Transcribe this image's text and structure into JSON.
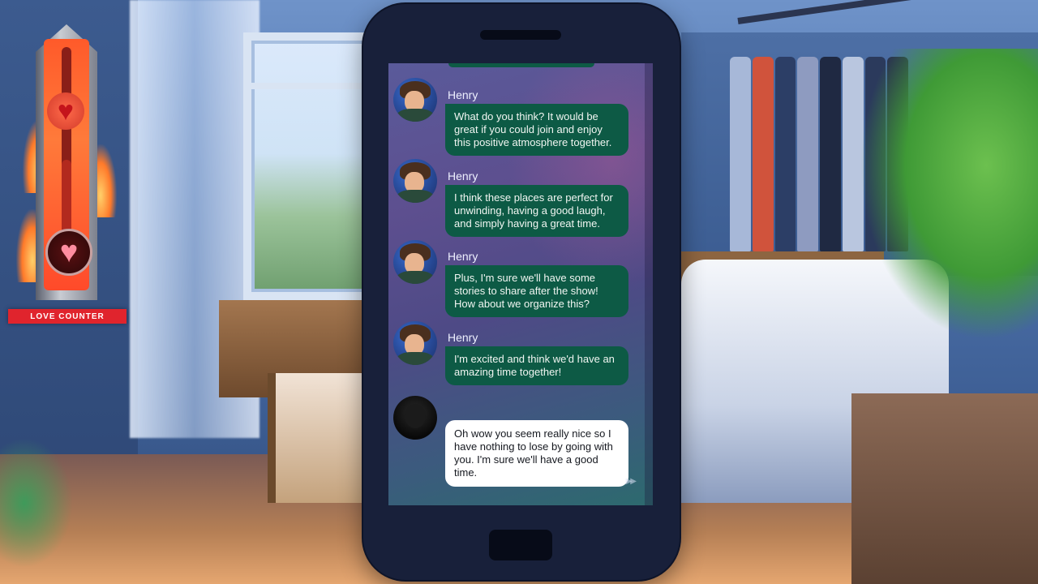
{
  "love_meter": {
    "label": "LOVE COUNTER",
    "level_fraction": 0.42,
    "colors": {
      "label_bg": "#e0242d",
      "meter_glow": "#ff5a2a"
    }
  },
  "chat": {
    "contact_name": "Henry",
    "messages": [
      {
        "sender": "Henry",
        "text": "What do you think? It would be great if you could join and enjoy this positive atmosphere together."
      },
      {
        "sender": "Henry",
        "text": "I think these places are perfect for unwinding, having a good laugh, and simply having a great time."
      },
      {
        "sender": "Henry",
        "text": "Plus, I'm sure we'll have some stories to share after the show! How about we organize this?"
      },
      {
        "sender": "Henry",
        "text": "I'm excited and think we'd have an amazing time together!"
      }
    ],
    "player_message": {
      "text": "Oh wow you seem really nice so I have nothing to lose by going with you. I'm sure we'll have a good time."
    },
    "colors": {
      "npc_bubble": "#0d5a45",
      "player_bubble": "#ffffff"
    }
  },
  "icons": {
    "fast_forward": "fast-forward-icon",
    "heart": "heart-icon"
  }
}
